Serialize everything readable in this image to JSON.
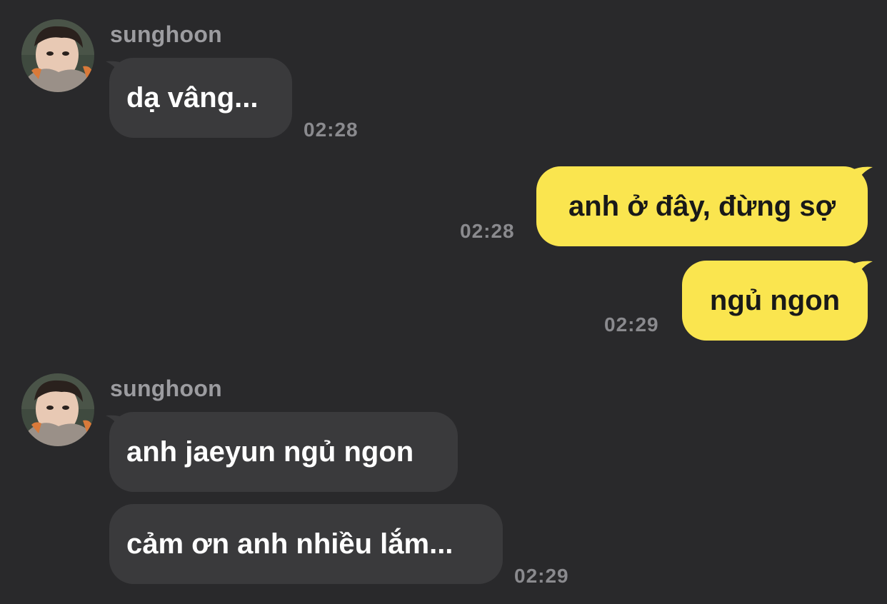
{
  "chat": {
    "messages": [
      {
        "sender": "sunghoon",
        "text": "dạ vâng...",
        "time": "02:28"
      },
      {
        "text": "anh ở đây, đừng sợ",
        "time": "02:28"
      },
      {
        "text": "ngủ ngon",
        "time": "02:29"
      },
      {
        "sender": "sunghoon",
        "text": "anh jaeyun ngủ ngon"
      },
      {
        "text": "cảm ơn anh nhiều lắm...",
        "time": "02:29"
      }
    ]
  },
  "colors": {
    "background": "#29292b",
    "incoming_bubble": "#3a3a3c",
    "outgoing_bubble": "#fae54f",
    "timestamp": "#8a8a8e",
    "sender_name": "#9c9ca0"
  },
  "icons": {
    "avatar": "profile-photo-avatar"
  }
}
